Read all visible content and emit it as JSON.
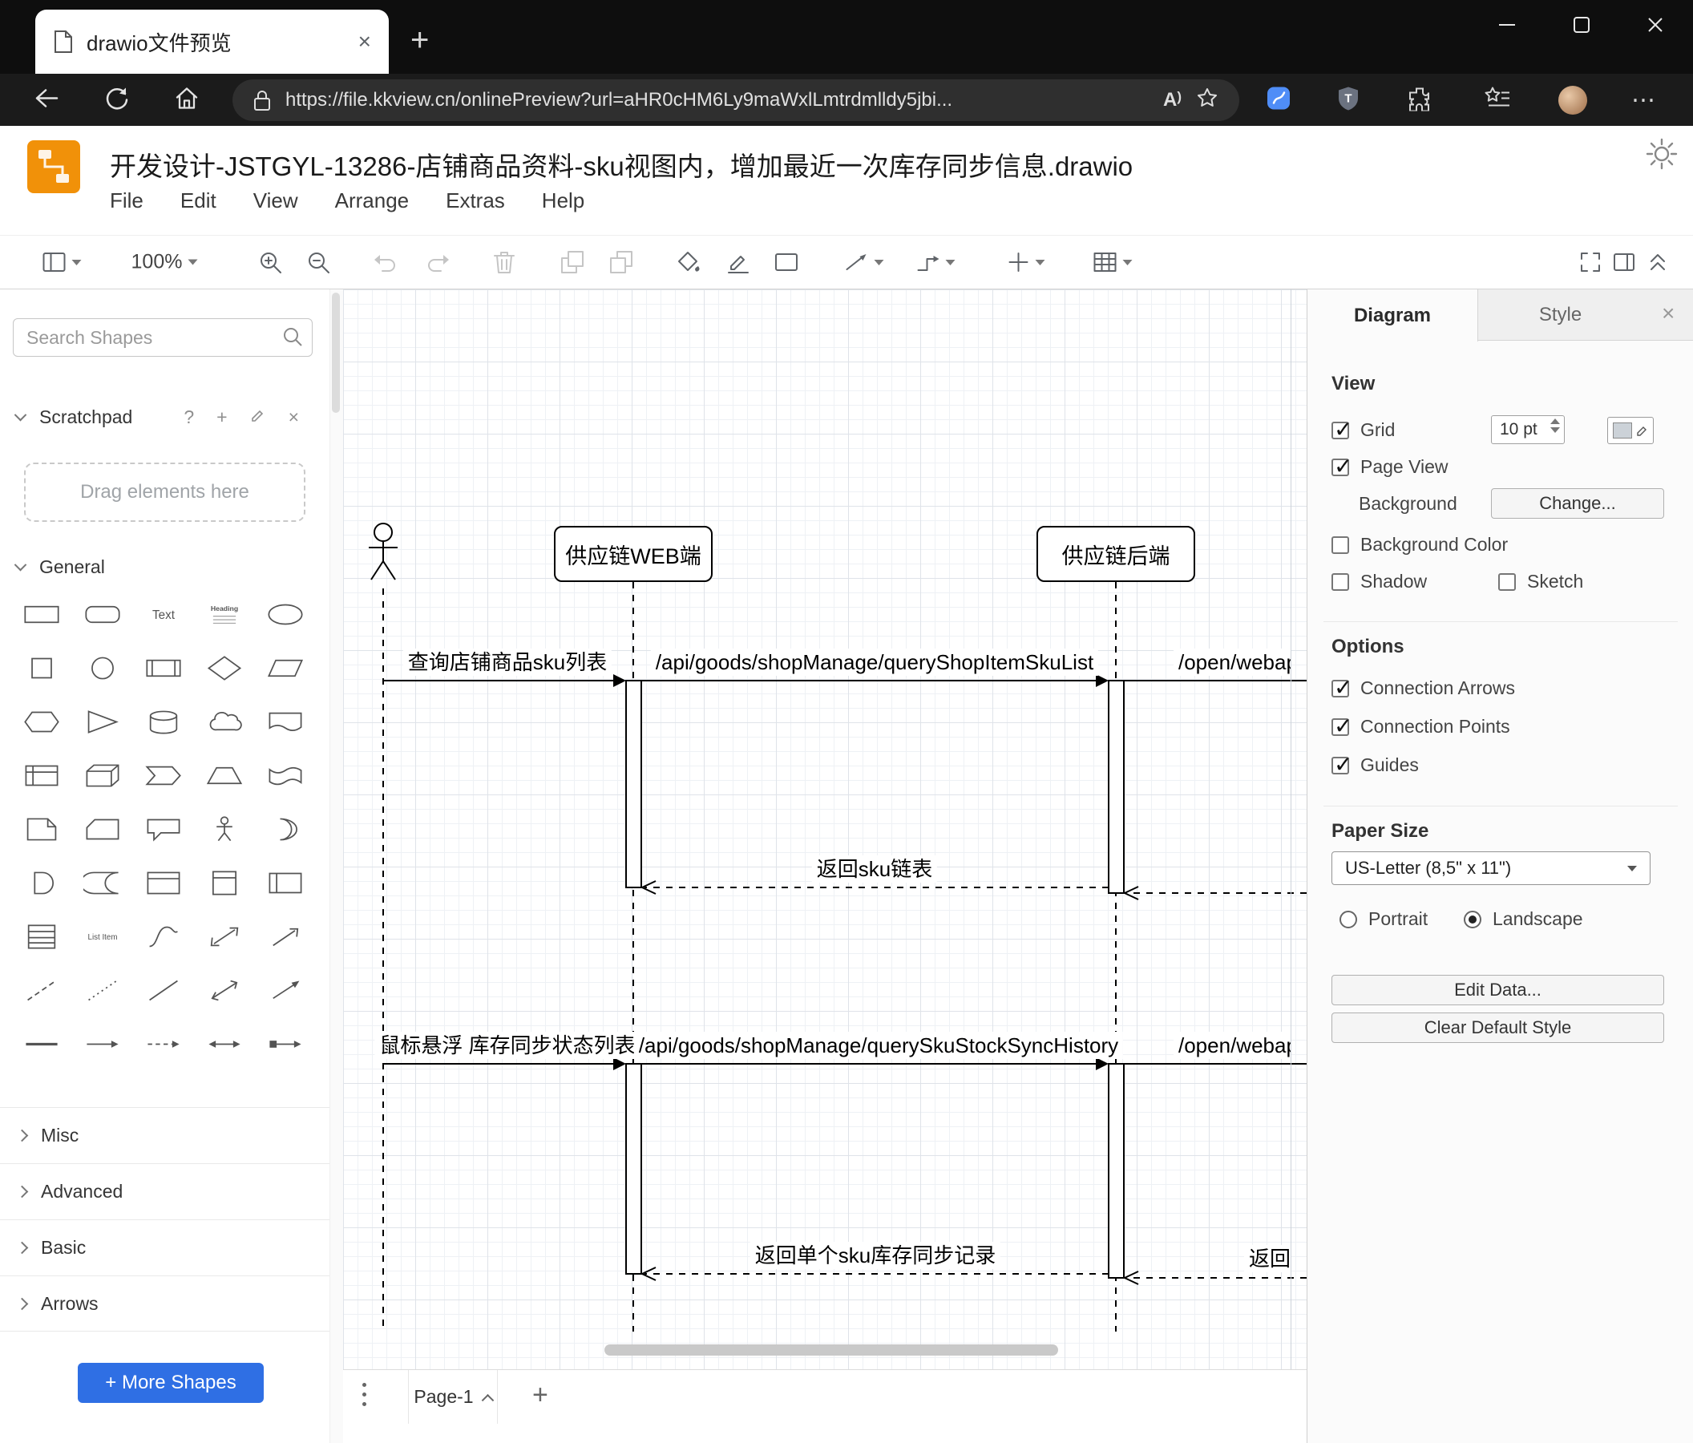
{
  "browser": {
    "tab_title": "drawio文件预览",
    "url": "https://file.kkview.cn/onlinePreview?url=aHR0cHM6Ly9maWxlLmtrdmlldy5jbi...",
    "accent_blue": "#4f8df7"
  },
  "app": {
    "title": "开发设计-JSTGYL-13286-店铺商品资料-sku视图内，增加最近一次库存同步信息.drawio",
    "menus": [
      "File",
      "Edit",
      "View",
      "Arrange",
      "Extras",
      "Help"
    ],
    "zoom_level": "100%",
    "logo_color": "#f19109"
  },
  "sidebar": {
    "search_placeholder": "Search Shapes",
    "scratchpad_label": "Scratchpad",
    "drag_hint": "Drag elements here",
    "sections": {
      "general": "General",
      "misc": "Misc",
      "advanced": "Advanced",
      "basic": "Basic",
      "arrows": "Arrows"
    },
    "more_shapes_label": "+ More Shapes",
    "shapes": [
      "rectangle",
      "rounded-rectangle",
      "text",
      "heading",
      "ellipse",
      "square",
      "circle",
      "process",
      "diamond",
      "parallelogram",
      "hexagon",
      "triangle",
      "cylinder",
      "cloud",
      "document",
      "internal-storage",
      "cube",
      "step",
      "trapezoid",
      "tape",
      "note",
      "card",
      "callout",
      "actor",
      "or",
      "and",
      "data-storage",
      "container",
      "vertical-container",
      "horizontal-container",
      "list",
      "list-item",
      "curve",
      "bidirectional-arrow",
      "arrow",
      "dashed-line",
      "dotted-line",
      "line",
      "bidirectional-connector",
      "directional-connector",
      "horizontal-line",
      "horizontal-arrow",
      "dashed-horizontal-arrow",
      "double-horizontal-arrow",
      "cross-arrow"
    ]
  },
  "canvas": {
    "participants": [
      {
        "label": "供应链WEB端"
      },
      {
        "label": "供应链后端"
      }
    ],
    "messages": [
      {
        "id": "m1",
        "label": "查询店铺商品sku列表"
      },
      {
        "id": "m2",
        "label": "/api/goods/shopManage/queryShopItemSkuList"
      },
      {
        "id": "m3",
        "label": "/open/webapi/"
      },
      {
        "id": "r1",
        "label": "返回sku链表"
      },
      {
        "id": "m4",
        "label": "鼠标悬浮 库存同步状态列表"
      },
      {
        "id": "m5",
        "label": "/api/goods/shopManage/querySkuStockSyncHistory"
      },
      {
        "id": "m6",
        "label": "/open/webapi/item"
      },
      {
        "id": "r2",
        "label": "返回单个sku库存同步记录"
      },
      {
        "id": "r3",
        "label": "返回"
      }
    ]
  },
  "panel": {
    "tabs": {
      "diagram": "Diagram",
      "style": "Style"
    },
    "view": {
      "heading": "View",
      "grid_label": "Grid",
      "grid_checked": true,
      "grid_size": "10 pt",
      "page_view_label": "Page View",
      "page_view_checked": true,
      "background_label": "Background",
      "change_label": "Change...",
      "background_color_label": "Background Color",
      "background_color_checked": false,
      "shadow_label": "Shadow",
      "shadow_checked": false,
      "sketch_label": "Sketch",
      "sketch_checked": false
    },
    "options": {
      "heading": "Options",
      "connection_arrows_label": "Connection Arrows",
      "connection_arrows_checked": true,
      "connection_points_label": "Connection Points",
      "connection_points_checked": true,
      "guides_label": "Guides",
      "guides_checked": true
    },
    "paper": {
      "heading": "Paper Size",
      "value": "US-Letter (8,5\" x 11\")",
      "portrait_label": "Portrait",
      "portrait_checked": false,
      "landscape_label": "Landscape",
      "landscape_checked": true
    },
    "buttons": {
      "edit_data": "Edit Data...",
      "clear_default_style": "Clear Default Style"
    }
  },
  "footer": {
    "page_label": "Page-1"
  }
}
